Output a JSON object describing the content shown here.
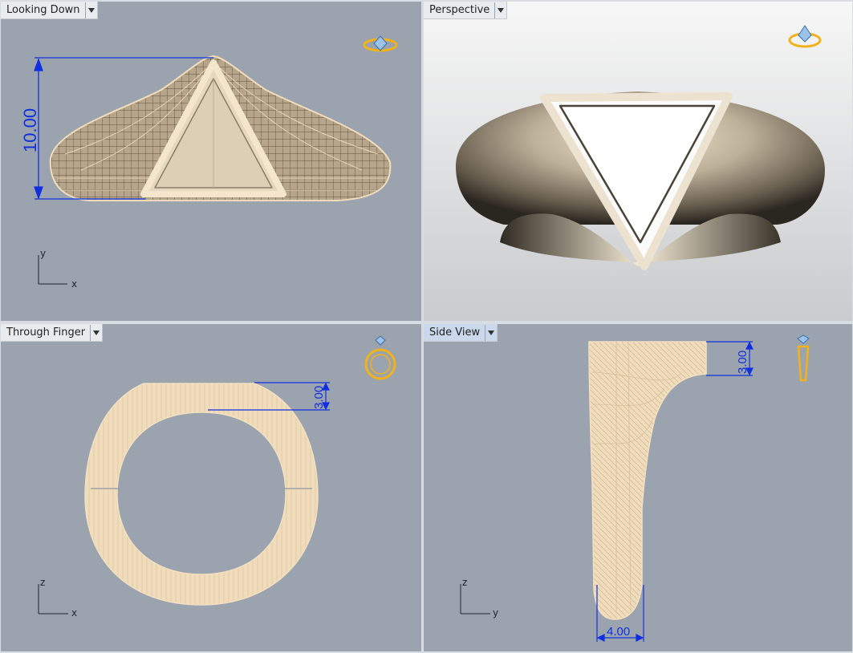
{
  "viewports": {
    "top": {
      "title": "Looking Down",
      "dimension": "10.00",
      "axis_h": "x",
      "axis_v": "y"
    },
    "perspective": {
      "title": "Perspective"
    },
    "front": {
      "title": "Through Finger",
      "dimension": "3.00",
      "axis_h": "x",
      "axis_v": "z"
    },
    "side": {
      "title": "Side View",
      "dimension_top": "3.00",
      "dimension_bottom": "4.00",
      "axis_h": "y",
      "axis_v": "z"
    }
  },
  "icons": {
    "dropdown": "chevron-down-icon",
    "view_widget": "ring-view-widget-icon"
  },
  "colors": {
    "viewport_bg": "#9aa3ae",
    "wire": "#f1dcbc",
    "dimension": "#1030e0",
    "widget": "#f2b21b"
  }
}
